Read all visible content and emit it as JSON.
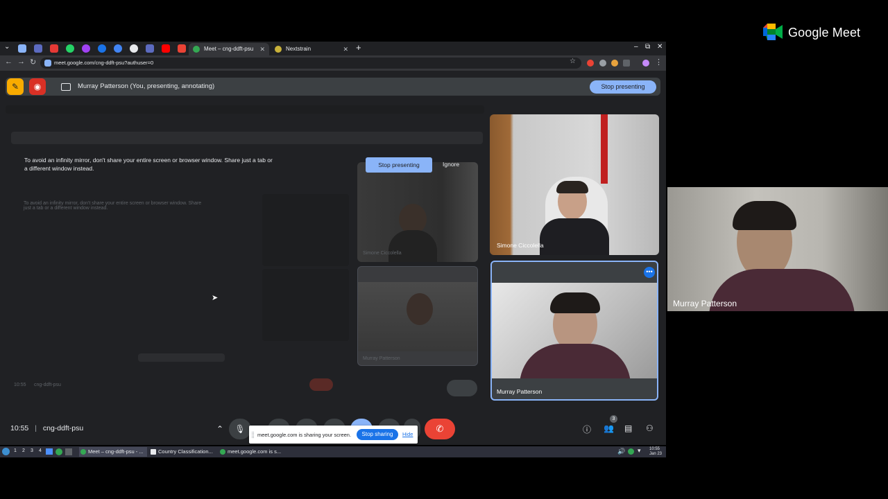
{
  "browser": {
    "tabs": [
      {
        "label": "Meet – cng-ddft-psu",
        "active": true
      },
      {
        "label": "Nextstrain",
        "active": false
      }
    ],
    "url": "meet.google.com/cng-ddft-psu?authuser=0"
  },
  "meet": {
    "presenting_banner": "Murray Patterson (You, presenting, annotating)",
    "stop_presenting_label": "Stop presenting",
    "infinity_warning": "To avoid an infinity mirror, don't share your entire screen or browser window. Share just a tab or a different window instead.",
    "warning_stop_label": "Stop presenting",
    "ignore_label": "Ignore",
    "participants": [
      {
        "name": "Simone Ciccolella"
      },
      {
        "name": "Murray Patterson"
      }
    ],
    "time": "10:55",
    "meeting_code": "cng-ddft-psu",
    "people_count": "3",
    "share_popup": {
      "message": "meet.google.com is sharing your screen.",
      "stop_label": "Stop sharing",
      "hide_label": "Hide"
    },
    "mirror_ghost": {
      "time": "10:55",
      "code": "cng-ddft-psu",
      "warning": "To avoid an infinity mirror, don't share your entire screen or browser window. Share just a tab or a different window instead.",
      "stop_label": "Stop presenting",
      "ignore_label": "Ignore",
      "name1": "Simone Ciccolella",
      "name2": "Murray Patterson"
    }
  },
  "taskbar": {
    "workspaces": [
      "1",
      "2",
      "3",
      "4"
    ],
    "tasks": [
      {
        "label": "Meet – cng-ddft-psu - ...",
        "active": true
      },
      {
        "label": "Country Classification...",
        "active": false
      },
      {
        "label": "meet.google.com is s...",
        "active": false
      }
    ],
    "clock_time": "10:55",
    "clock_date": "Jan 23"
  },
  "right_panel": {
    "app_title": "Google Meet",
    "self_name": "Murray Patterson"
  },
  "colors": {
    "accent_blue": "#8ab4f8",
    "end_call_red": "#ea4335",
    "page_bg": "#202124"
  }
}
